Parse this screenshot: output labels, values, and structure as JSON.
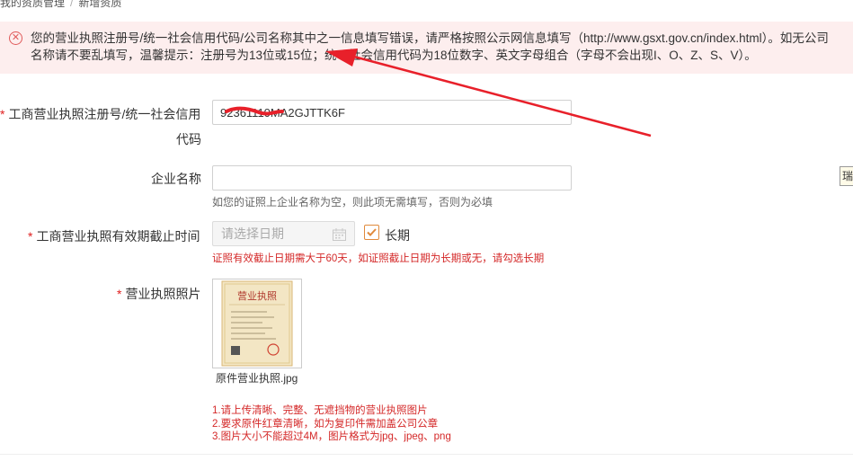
{
  "breadcrumb": {
    "parent": "我的资质管理",
    "separator": "/",
    "current": "新增资质"
  },
  "alert": {
    "icon": "error-circle-icon",
    "message": "您的营业执照注册号/统一社会信用代码/公司名称其中之一信息填写错误，请严格按照公示网信息填写（http://www.gsxt.gov.cn/index.html）。如无公司名称请不要乱填写，温馨提示：注册号为13位或15位；统一社会信用代码为18位数字、英文字母组合（字母不会出现I、O、Z、S、V）。"
  },
  "form": {
    "license_no": {
      "required_mark": "*",
      "label_line1": "工商营业执照注册号/统一社会信用",
      "label_line2": "代码",
      "value": "92361110MA2GJTTK6F"
    },
    "company_name": {
      "label": "企业名称",
      "value": "",
      "hint": "如您的证照上企业名称为空，则此项无需填写，否则为必填"
    },
    "expiry": {
      "required_mark": "*",
      "label": "工商营业执照有效期截止时间",
      "placeholder": "请选择日期",
      "checkbox_label": "长期",
      "checked": true,
      "error": "证照有效截止日期需大于60天，如证照截止日期为长期或无，请勾选长期"
    },
    "photo": {
      "required_mark": "*",
      "label": "营业执照照片",
      "thumbnail_title": "营业执照",
      "file_name": "原件营业执照.jpg"
    }
  },
  "upload_tips": [
    "1.请上传清晰、完整、无遮挡物的营业执照图片",
    "2.要求原件红章清晰，如为复印件需加盖公司公章",
    "3.图片大小不能超过4M，图片格式为jpg、jpeg、png"
  ],
  "side_tag": "瑞",
  "colors": {
    "required": "#e02020",
    "error_text": "#d42828",
    "alert_bg": "#fdeeee",
    "checkbox": "#e08a3c",
    "annotation_arrow": "#e8202a"
  }
}
